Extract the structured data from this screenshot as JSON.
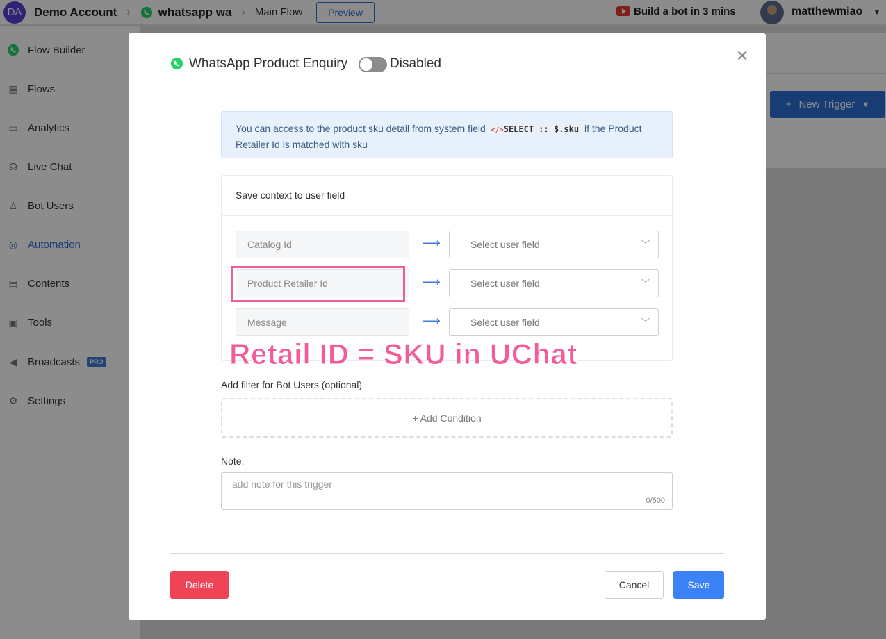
{
  "topbar": {
    "avatar_initials": "DA",
    "account_name": "Demo Account",
    "bot_name": "whatsapp wa",
    "flow_name": "Main Flow",
    "preview_label": "Preview",
    "build_label": "Build a bot in 3 mins",
    "username": "matthewmiao"
  },
  "sidebar": {
    "items": [
      {
        "label": "Flow Builder",
        "icon": "whatsapp-icon"
      },
      {
        "label": "Flows",
        "icon": "grid-icon"
      },
      {
        "label": "Analytics",
        "icon": "chart-icon"
      },
      {
        "label": "Live Chat",
        "icon": "headset-icon"
      },
      {
        "label": "Bot Users",
        "icon": "user-icon"
      },
      {
        "label": "Automation",
        "icon": "lifebuoy-icon",
        "active": true
      },
      {
        "label": "Contents",
        "icon": "document-icon"
      },
      {
        "label": "Tools",
        "icon": "toolbox-icon"
      },
      {
        "label": "Broadcasts",
        "icon": "megaphone-icon",
        "badge": "PRO"
      },
      {
        "label": "Settings",
        "icon": "gear-icon"
      }
    ]
  },
  "background": {
    "new_trigger_label": "New Trigger"
  },
  "modal": {
    "title": "WhatsApp Product Enquiry",
    "toggle_label": "Disabled",
    "toggle_enabled": false,
    "info": {
      "text_before": "You can access to the product sku detail from system field",
      "code": "SELECT :: $.sku",
      "text_after": "if the Product Retailer Id is matched with sku"
    },
    "context": {
      "title": "Save context to user field",
      "rows": [
        {
          "source": "Catalog Id",
          "target_placeholder": "Select user field"
        },
        {
          "source": "Product Retailer Id",
          "target_placeholder": "Select user field"
        },
        {
          "source": "Message",
          "target_placeholder": "Select user field"
        }
      ]
    },
    "annotation_text": "Retail ID = SKU in UChat",
    "filter_label": "Add filter for Bot Users (optional)",
    "add_condition_label": "+ Add Condition",
    "note_label": "Note:",
    "note_placeholder": "add note for this trigger",
    "note_counter": "0/500",
    "buttons": {
      "delete": "Delete",
      "cancel": "Cancel",
      "save": "Save"
    }
  },
  "colors": {
    "primary": "#3b82f6",
    "danger": "#ef4455",
    "highlight": "#ee5e99",
    "whatsapp": "#25d366"
  }
}
